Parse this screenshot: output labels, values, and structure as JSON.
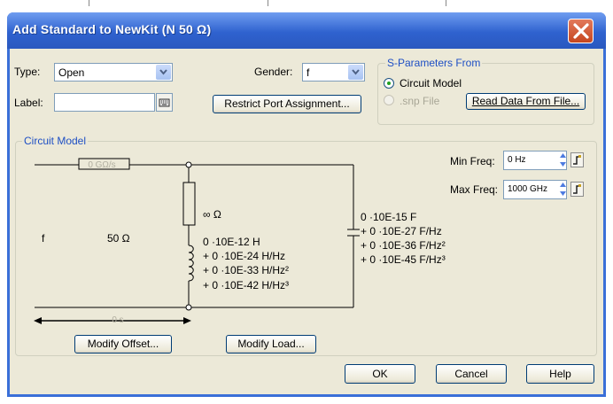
{
  "window": {
    "title": "Add Standard to NewKit (N 50 Ω)"
  },
  "type": {
    "label": "Type:",
    "value": "Open"
  },
  "gender": {
    "label": "Gender:",
    "value": "f"
  },
  "label_field": {
    "label": "Label:",
    "value": ""
  },
  "restrict_button": "Restrict Port Assignment...",
  "sparams": {
    "title": "S-Parameters From",
    "circuit_model": "Circuit Model",
    "snp_file": ".snp File",
    "read_button": "Read Data From File..."
  },
  "circuit": {
    "title": "Circuit Model",
    "port_label": "f",
    "impedance": "50 Ω",
    "offset_z": "0 GΩ/s",
    "offset_delay": "0 s",
    "resistor": "∞ Ω",
    "inductor_lines": [
      "0 ·10E-12 H",
      "+ 0 ·10E-24 H/Hz",
      "+ 0 ·10E-33 H/Hz²",
      "+ 0 ·10E-42 H/Hz³"
    ],
    "capacitor_lines": [
      "0 ·10E-15 F",
      "+ 0 ·10E-27 F/Hz",
      "+ 0 ·10E-36 F/Hz²",
      "+ 0 ·10E-45 F/Hz³"
    ],
    "modify_offset": "Modify Offset...",
    "modify_load": "Modify Load..."
  },
  "freq": {
    "min_label": "Min Freq:",
    "min_value": "0 Hz",
    "max_label": "Max Freq:",
    "max_value": "1000 GHz"
  },
  "footer": {
    "ok": "OK",
    "cancel": "Cancel",
    "help": "Help"
  },
  "colors": {
    "titlebar": "#2f62cf",
    "close": "#c6461f",
    "dialog": "#ece9d8",
    "group_title": "#1e4fc4"
  }
}
